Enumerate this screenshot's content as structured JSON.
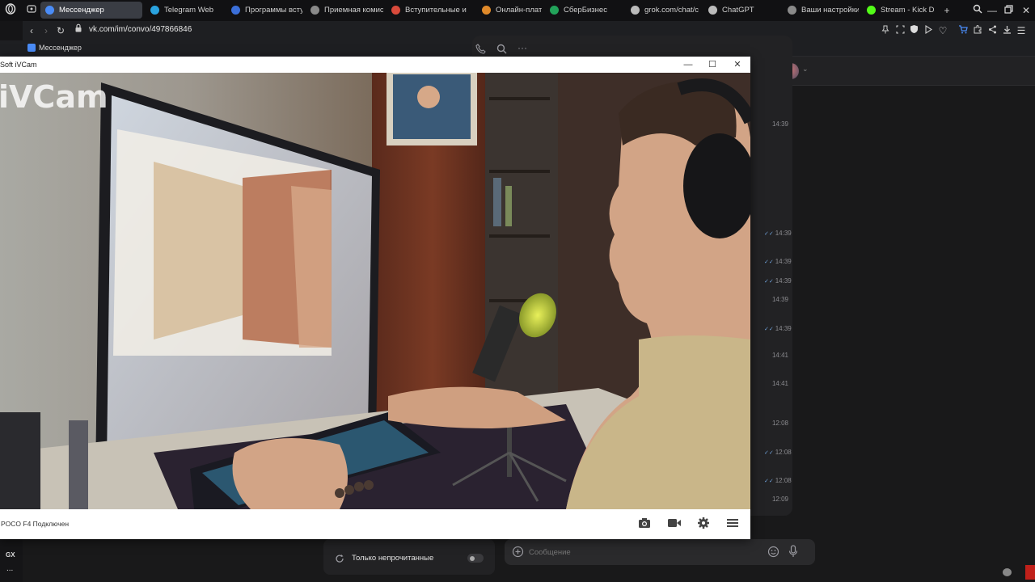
{
  "browser": {
    "tabs": [
      {
        "label": "Мессенджер",
        "color": "#4a8cf7",
        "active": true
      },
      {
        "label": "Telegram Web",
        "color": "#2aa3df"
      },
      {
        "label": "Программы всту",
        "color": "#3b6fd9"
      },
      {
        "label": "Приемная комис",
        "color": "#8a8a8a"
      },
      {
        "label": "Вступительные и",
        "color": "#d94a3b"
      },
      {
        "label": "Онлайн-платфор",
        "color": "#e08a2a"
      },
      {
        "label": "СберБизнес",
        "color": "#22a35a"
      },
      {
        "label": "grok.com/chat/c",
        "color": "#bbbbbb"
      },
      {
        "label": "ChatGPT",
        "color": "#bbbbbb"
      },
      {
        "label": "Ваши настройки",
        "color": "#8a8a8a"
      },
      {
        "label": "Stream - Kick Da",
        "color": "#53fc18"
      }
    ],
    "url": "vk.com/im/convo/497866846",
    "bookmark_label": "Мессенджер"
  },
  "gx": {
    "label": "GX",
    "more": "..."
  },
  "ivcam": {
    "title": "Soft iVCam",
    "video_overlay": "iVCam",
    "status": "POCO F4 Подключен"
  },
  "vk": {
    "times": [
      {
        "t": "14:39",
        "read": false
      },
      {
        "t": "14:39",
        "read": true
      },
      {
        "t": "14:39",
        "read": true
      },
      {
        "t": "14:39",
        "read": true
      },
      {
        "t": "14:39",
        "read": false
      },
      {
        "t": "14:39",
        "read": true
      },
      {
        "t": "14:41",
        "read": false
      },
      {
        "t": "14:41",
        "read": false
      },
      {
        "t": "12:08",
        "read": false
      },
      {
        "t": "12:08",
        "read": true
      },
      {
        "t": "12:08",
        "read": true
      },
      {
        "t": "12:09",
        "read": false
      }
    ],
    "unread_only": "Только непрочитанные",
    "message_placeholder": "Сообщение"
  }
}
